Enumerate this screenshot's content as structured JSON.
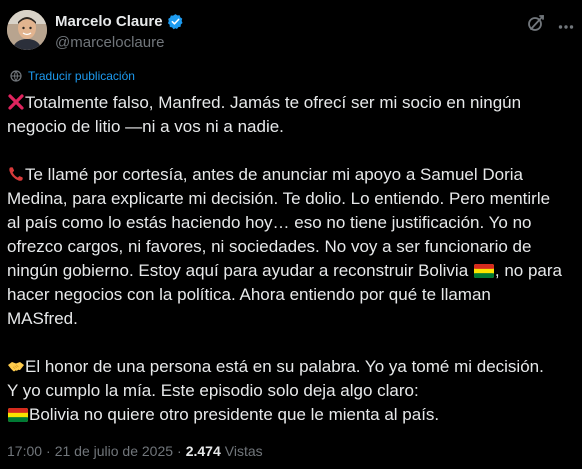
{
  "author": {
    "display_name": "Marcelo Claure",
    "handle": "@marceloclaure",
    "verified": true,
    "avatar_icon": "avatar-photo"
  },
  "actions": {
    "grok_icon": "grok-icon",
    "more_icon": "more-options-icon"
  },
  "translate": {
    "label": "Traducir publicación",
    "icon": "globe-translate-icon"
  },
  "tweet": {
    "p1_text": "Totalmente falso, Manfred. Jamás te ofrecí ser mi socio en ningún\nnegocio de litio —ni a vos ni a nadie.",
    "p2_text_a": "Te llamé por cortesía, antes de anunciar mi apoyo a Samuel Doria\nMedina, para explicarte mi decisión. Te dolio. Lo entiendo. Pero mentirle\nal país como lo estás haciendo hoy… eso no tiene justificación. Yo no\nofrezco cargos, ni favores, ni sociedades. No voy a ser funcionario de\nningún gobierno. Estoy aquí para ayudar a reconstruir Bolivia ",
    "p2_text_b": ", no para\nhacer negocios con la política. Ahora entiendo por qué te llaman\nMASfred.",
    "p3_text": "El honor de una persona está en su palabra. Yo ya tomé mi decisión.\nY yo cumplo la mía. Este episodio solo deja algo claro:\n",
    "p3_text_b": "Bolivia no quiere otro presidente que le mienta al país."
  },
  "meta": {
    "time": "17:00",
    "separator": "·",
    "date": "21 de julio de 2025",
    "views_count": "2.474",
    "views_label": "Vistas"
  },
  "colors": {
    "background": "#000000",
    "text": "#e7e9ea",
    "muted": "#71767b",
    "accent": "#1d9bf0",
    "verified": "#1d9bf0",
    "cross": "#e0245e",
    "flag_red": "#d52b1e",
    "flag_yellow": "#f9e300",
    "flag_green": "#007934"
  }
}
